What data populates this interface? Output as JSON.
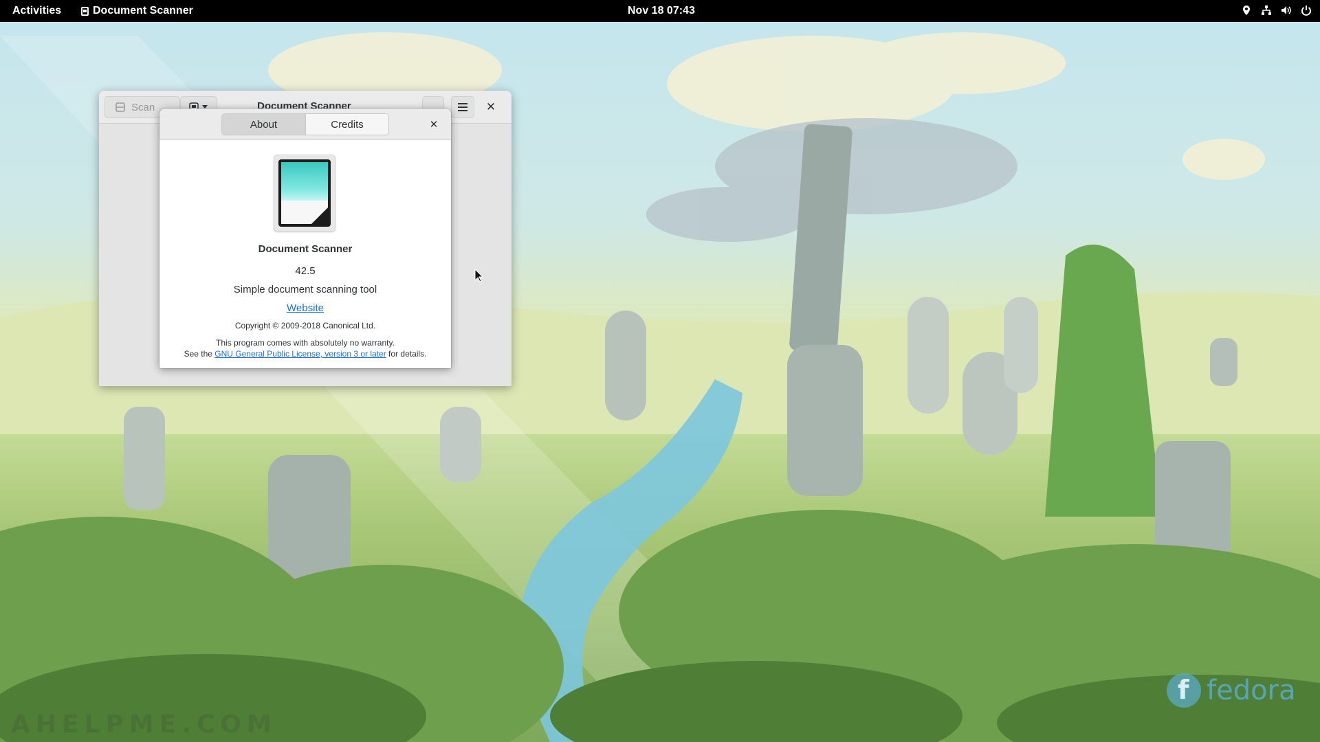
{
  "topbar": {
    "activities_label": "Activities",
    "app_menu_label": "Document Scanner",
    "clock": "Nov 18  07:43",
    "status_icons": [
      "location-icon",
      "network-icon",
      "volume-icon",
      "power-icon"
    ]
  },
  "main_window": {
    "title": "Document Scanner",
    "scan_label": "Scan"
  },
  "about_dialog": {
    "tabs": [
      {
        "label": "About",
        "active": true
      },
      {
        "label": "Credits",
        "active": false
      }
    ],
    "app_name": "Document Scanner",
    "version": "42.5",
    "description": "Simple document scanning tool",
    "website_label": "Website",
    "copyright": "Copyright © 2009-2018 Canonical Ltd.",
    "warranty_line1": "This program comes with absolutely no warranty.",
    "warranty_prefix": "See the ",
    "license_link": "GNU General Public License, version 3 or later",
    "warranty_suffix": " for details."
  },
  "desktop": {
    "watermark": "AHELPME.COM",
    "distro_logo": "fedora"
  },
  "colors": {
    "link": "#1c71d8",
    "topbar_bg": "#000000",
    "icon_accent": "#3cc8c0"
  }
}
